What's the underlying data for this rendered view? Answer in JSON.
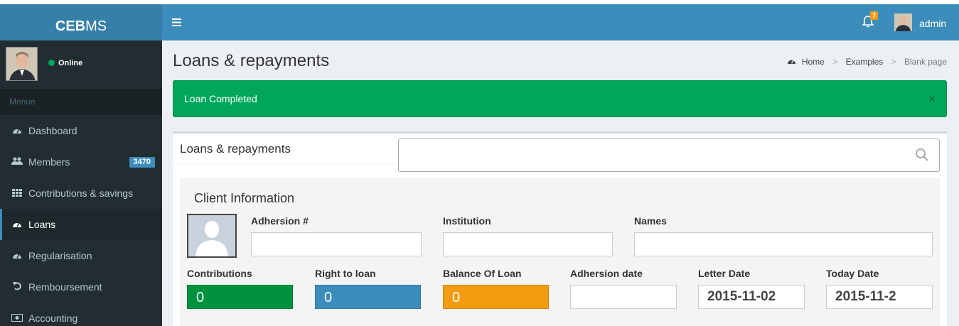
{
  "app": {
    "logo_bold": "CEB",
    "logo_rest": "MS"
  },
  "sidebar": {
    "status": "Online",
    "menu_header": "Menue",
    "items": [
      {
        "label": "Dashboard",
        "icon": "dashboard-icon"
      },
      {
        "label": "Members",
        "icon": "users-icon",
        "badge": "3470"
      },
      {
        "label": "Contributions & savings",
        "icon": "grid-icon"
      },
      {
        "label": "Loans",
        "icon": "dashboard-icon"
      },
      {
        "label": "Regularisation",
        "icon": "dashboard-icon"
      },
      {
        "label": "Remboursement",
        "icon": "undo-icon"
      },
      {
        "label": "Accounting",
        "icon": "money-icon"
      }
    ]
  },
  "topbar": {
    "notifications": "7",
    "username": "admin"
  },
  "page": {
    "title": "Loans & repayments",
    "breadcrumb": [
      "Home",
      "Examples",
      "Blank page"
    ]
  },
  "alert": {
    "message": "Loan Completed",
    "close": "×"
  },
  "box": {
    "title": "Loans & repayments",
    "search_placeholder": ""
  },
  "client": {
    "title": "Client Information",
    "adhersion_label": "Adhersion #",
    "institution_label": "Institution",
    "names_label": "Names",
    "contributions_label": "Contributions",
    "contributions_value": "0",
    "right_to_loan_label": "Right to loan",
    "right_to_loan_value": "0",
    "balance_label": "Balance Of Loan",
    "balance_value": "0",
    "adhersion_date_label": "Adhersion date",
    "letter_date_label": "Letter Date",
    "letter_date_value": "2015-11-02",
    "today_date_label": "Today Date",
    "today_date_value": "2015-11-2"
  },
  "colors": {
    "brand": "#3c8dbc",
    "success": "#00a65a",
    "contributions": "#00923f",
    "right_to_loan": "#3c8dbc",
    "balance": "#f39c12"
  }
}
